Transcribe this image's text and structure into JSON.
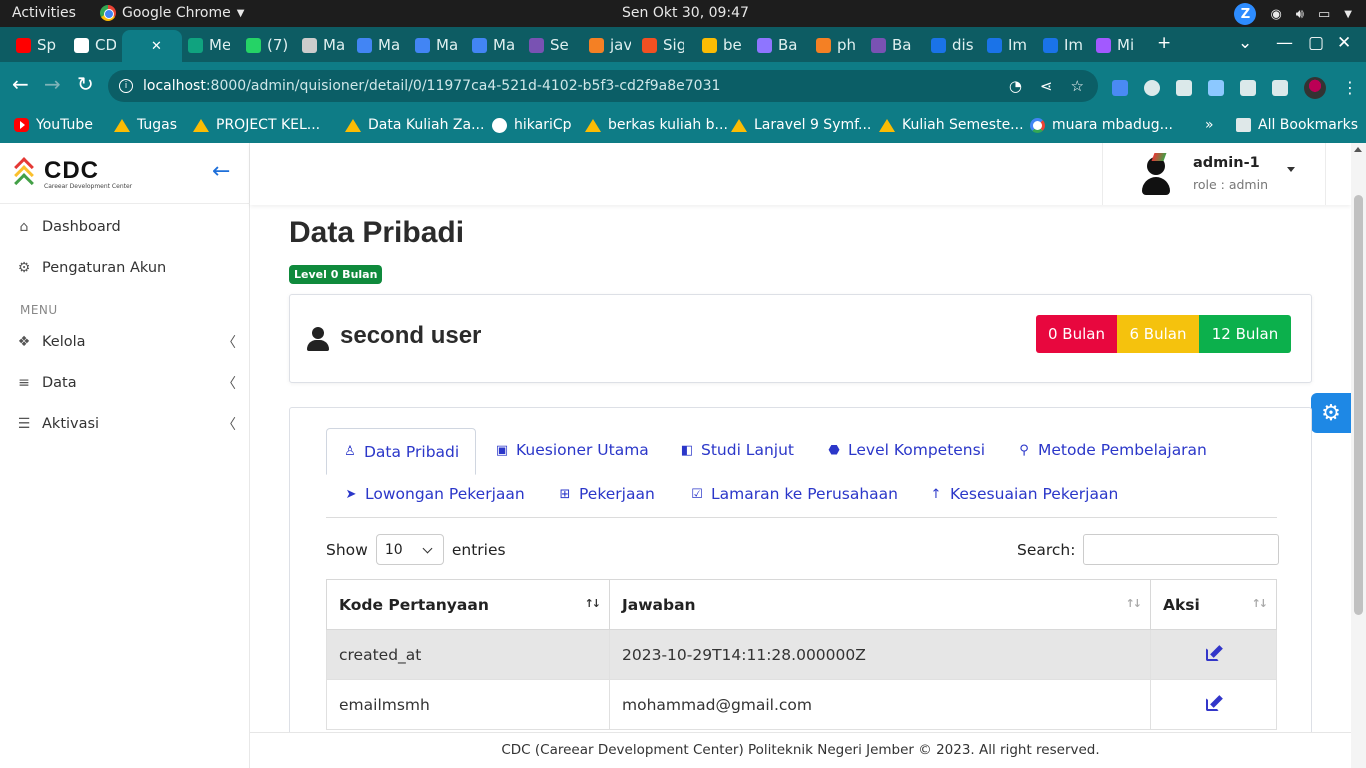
{
  "system": {
    "activities": "Activities",
    "app_name": "Google Chrome",
    "clock": "Sen Okt 30, 09:47"
  },
  "browser": {
    "tabs": [
      {
        "label": "Sp",
        "color": "#ff0000"
      },
      {
        "label": "CD",
        "color": "#ffffff"
      },
      {
        "label": "",
        "color": "#0e7c86",
        "active": true
      },
      {
        "label": "Me",
        "color": "#10a37f"
      },
      {
        "label": "(7)",
        "color": "#25d366"
      },
      {
        "label": "Ma",
        "color": "#cccccc"
      },
      {
        "label": "Ma",
        "color": "#4285f4"
      },
      {
        "label": "Ma",
        "color": "#4285f4"
      },
      {
        "label": "Ma",
        "color": "#4285f4"
      },
      {
        "label": "Se",
        "color": "#7952b3"
      },
      {
        "label": "jav",
        "color": "#f48024"
      },
      {
        "label": "Sig",
        "color": "#f25022"
      },
      {
        "label": "be",
        "color": "#fbbc04"
      },
      {
        "label": "Ba",
        "color": "#8e75ff"
      },
      {
        "label": "ph",
        "color": "#f48024"
      },
      {
        "label": "Ba",
        "color": "#7952b3"
      },
      {
        "label": "dis",
        "color": "#1a73e8"
      },
      {
        "label": "Im",
        "color": "#1a73e8"
      },
      {
        "label": "Im",
        "color": "#1a73e8"
      },
      {
        "label": "Mi",
        "color": "#a259ff"
      }
    ],
    "url_host": "localhost",
    "url_path": ":8000/admin/quisioner/detail/0/11977ca4-521d-4102-b5f3-cd2f9a8e7031",
    "bookmarks": [
      {
        "label": "YouTube",
        "icon": "youtube-icon"
      },
      {
        "label": "Tugas",
        "icon": "drive-icon"
      },
      {
        "label": "PROJECT KEL...",
        "icon": "drive-icon"
      },
      {
        "label": "Data Kuliah Za...",
        "icon": "drive-icon"
      },
      {
        "label": "hikariCp",
        "icon": "github-icon"
      },
      {
        "label": "berkas kuliah b...",
        "icon": "drive-icon"
      },
      {
        "label": "Laravel 9 Symf...",
        "icon": "laravel-icon"
      },
      {
        "label": "Kuliah Semeste...",
        "icon": "drive-icon"
      },
      {
        "label": "muara mbadug...",
        "icon": "google-icon"
      }
    ],
    "all_bookmarks": "All Bookmarks"
  },
  "sidebar": {
    "brand": "CDC",
    "brand_sub": "Careear Development Center",
    "items": [
      {
        "label": "Dashboard",
        "icon": "home-icon"
      },
      {
        "label": "Pengaturan Akun",
        "icon": "user-gear-icon"
      }
    ],
    "menu_heading": "MENU",
    "menu_items": [
      {
        "label": "Kelola",
        "icon": "cubes-icon"
      },
      {
        "label": "Data",
        "icon": "database-icon"
      },
      {
        "label": "Aktivasi",
        "icon": "list-icon"
      }
    ]
  },
  "header": {
    "user_name": "admin-1",
    "user_role": "role : admin"
  },
  "main": {
    "title": "Data Pribadi",
    "level_badge": "Level 0 Bulan",
    "user_display": "second user",
    "level_buttons": [
      "0 Bulan",
      "6 Bulan",
      "12 Bulan"
    ],
    "tabs": [
      {
        "label": "Data Pribadi",
        "icon": "user-outline-icon",
        "active": true
      },
      {
        "label": "Kuesioner Utama",
        "icon": "id-badge-icon"
      },
      {
        "label": "Studi Lanjut",
        "icon": "book-icon"
      },
      {
        "label": "Level Kompetensi",
        "icon": "octagon-icon"
      },
      {
        "label": "Metode Pembelajaran",
        "icon": "search-icon"
      },
      {
        "label": "Lowongan Pekerjaan",
        "icon": "paper-plane-icon"
      },
      {
        "label": "Pekerjaan",
        "icon": "grid-icon"
      },
      {
        "label": "Lamaran ke Perusahaan",
        "icon": "check-square-icon"
      },
      {
        "label": "Kesesuaian Pekerjaan",
        "icon": "arrow-up-icon"
      }
    ],
    "table_controls": {
      "show_label": "Show",
      "entries_value": "10",
      "entries_label": "entries",
      "search_label": "Search:"
    },
    "table": {
      "columns": [
        "Kode Pertanyaan",
        "Jawaban",
        "Aksi"
      ],
      "rows": [
        {
          "kode": "created_at",
          "jawaban": "2023-10-29T14:11:28.000000Z"
        },
        {
          "kode": "emailmsmh",
          "jawaban": "mohammad@gmail.com"
        }
      ]
    }
  },
  "footer": {
    "text": "CDC (Careear Development Center) Politeknik Negeri Jember © 2023. All right reserved."
  },
  "colors": {
    "browser_teal": "#0e7c86",
    "link_blue": "#2b37c9",
    "level_red": "#e8073e",
    "level_yellow": "#f5c20d",
    "level_green": "#0cb04c"
  }
}
